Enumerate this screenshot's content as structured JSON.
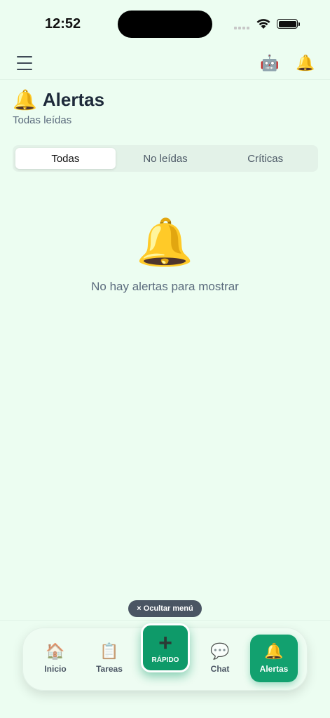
{
  "status_bar": {
    "time": "12:52"
  },
  "topbar": {
    "robot_icon": "🤖",
    "bell_icon": "🔔"
  },
  "header": {
    "emoji": "🔔",
    "title": "Alertas",
    "subtitle": "Todas leídas"
  },
  "tabs": [
    {
      "label": "Todas",
      "active": true
    },
    {
      "label": "No leídas",
      "active": false
    },
    {
      "label": "Críticas",
      "active": false
    }
  ],
  "empty_state": {
    "icon": "🔔",
    "message": "No hay alertas para mostrar"
  },
  "hide_menu": {
    "label": "× Ocultar menú"
  },
  "bottom_nav": {
    "items": [
      {
        "icon": "🏠",
        "label": "Inicio"
      },
      {
        "icon": "📋",
        "label": "Tareas"
      },
      {
        "icon": "💬",
        "label": "Chat"
      },
      {
        "icon": "🔔",
        "label": "Alertas"
      }
    ],
    "quick": {
      "icon": "+",
      "label": "RÁPIDO"
    }
  },
  "colors": {
    "background": "#ecfdf1",
    "accent": "#12a16f"
  }
}
